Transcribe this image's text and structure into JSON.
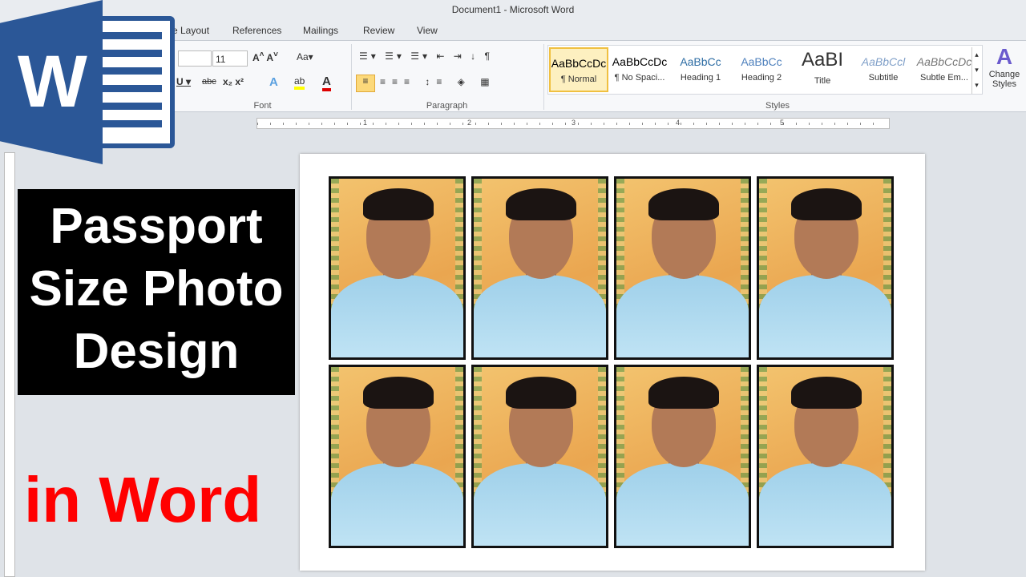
{
  "window": {
    "title": "Document1  -  Microsoft Word"
  },
  "tabs": [
    "e Layout",
    "References",
    "Mailings",
    "Review",
    "View"
  ],
  "font": {
    "size": "11",
    "group_label": "Font"
  },
  "paragraph": {
    "group_label": "Paragraph"
  },
  "styles": {
    "group_label": "Styles",
    "items": [
      {
        "sample": "AaBbCcDc",
        "label": "¶ Normal",
        "color": "#000000"
      },
      {
        "sample": "AaBbCcDc",
        "label": "¶ No Spaci...",
        "color": "#000000"
      },
      {
        "sample": "AaBbCc",
        "label": "Heading 1",
        "color": "#2e6da4"
      },
      {
        "sample": "AaBbCc",
        "label": "Heading 2",
        "color": "#4f81bd"
      },
      {
        "sample": "AaBI",
        "label": "Title",
        "color": "#333333"
      },
      {
        "sample": "AaBbCcl",
        "label": "Subtitle",
        "color": "#7f9fc8"
      },
      {
        "sample": "AaBbCcDc",
        "label": "Subtle Em...",
        "color": "#777777"
      }
    ],
    "change_styles": "Change Styles"
  },
  "ruler": [
    "1",
    "2",
    "3",
    "4",
    "5"
  ],
  "overlay": {
    "line1": "Passport",
    "line2": "Size Photo",
    "line3": "Design",
    "bottom": "in Word",
    "accent": "#ff0000"
  },
  "logo": {
    "letter": "W"
  },
  "photo_count": 8
}
